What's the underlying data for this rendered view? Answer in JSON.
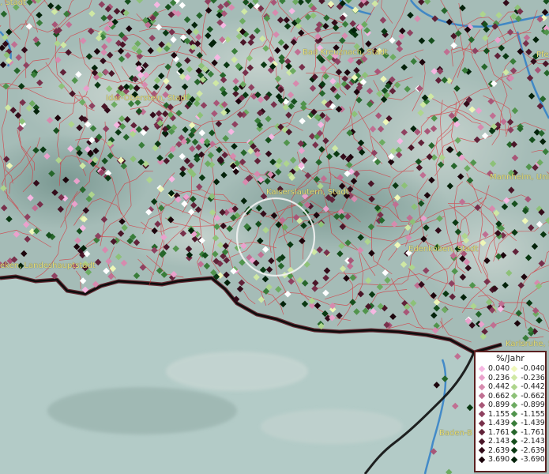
{
  "map": {
    "place_labels": [
      {
        "id": "label-top-left",
        "text": ", Stadt"
      },
      {
        "id": "label-bad-kreuznach",
        "text": "Bad Kreuznach, Stadt"
      },
      {
        "id": "label-top-right",
        "text": "Pfe"
      },
      {
        "id": "label-idar-oberstein",
        "text": "Idar-Oberstein, Stadt"
      },
      {
        "id": "label-kaiserslautern",
        "text": "Kaiserslautern, Stadt"
      },
      {
        "id": "label-mannheim",
        "text": "Mannheim, Univ"
      },
      {
        "id": "label-edenkoben",
        "text": "Edenkoben, Stadt"
      },
      {
        "id": "label-landeshauptstadt",
        "text": "eken, Landeshauptstadt"
      },
      {
        "id": "label-karlsruhe",
        "text": "Karlsruhe, S"
      },
      {
        "id": "label-baden",
        "text": "Baden-B"
      }
    ]
  },
  "legend": {
    "title": "%/Jahr",
    "positive": [
      {
        "value": "0.040",
        "color": "#f6b7e2"
      },
      {
        "value": "0.236",
        "color": "#eaa1cc"
      },
      {
        "value": "0.442",
        "color": "#d78aae"
      },
      {
        "value": "0.662",
        "color": "#c06f92"
      },
      {
        "value": "0.899",
        "color": "#a85677"
      },
      {
        "value": "1.155",
        "color": "#8f4160"
      },
      {
        "value": "1.439",
        "color": "#78304b"
      },
      {
        "value": "1.761",
        "color": "#612239"
      },
      {
        "value": "2.143",
        "color": "#4a1628"
      },
      {
        "value": "2.639",
        "color": "#330c1a"
      },
      {
        "value": "3.690",
        "color": "#1c050c"
      }
    ],
    "negative": [
      {
        "value": "-0.040",
        "color": "#eef7b8"
      },
      {
        "value": "-0.236",
        "color": "#cfe8a4"
      },
      {
        "value": "-0.442",
        "color": "#aed58d"
      },
      {
        "value": "-0.662",
        "color": "#8dc178"
      },
      {
        "value": "-0.899",
        "color": "#6dab61"
      },
      {
        "value": "-1.155",
        "color": "#51944c"
      },
      {
        "value": "-1.439",
        "color": "#397d3a"
      },
      {
        "value": "-1.761",
        "color": "#26662b"
      },
      {
        "value": "-2.143",
        "color": "#164f1d"
      },
      {
        "value": "-2.639",
        "color": "#0a3812"
      },
      {
        "value": "-3.690",
        "color": "#03220a"
      }
    ]
  }
}
